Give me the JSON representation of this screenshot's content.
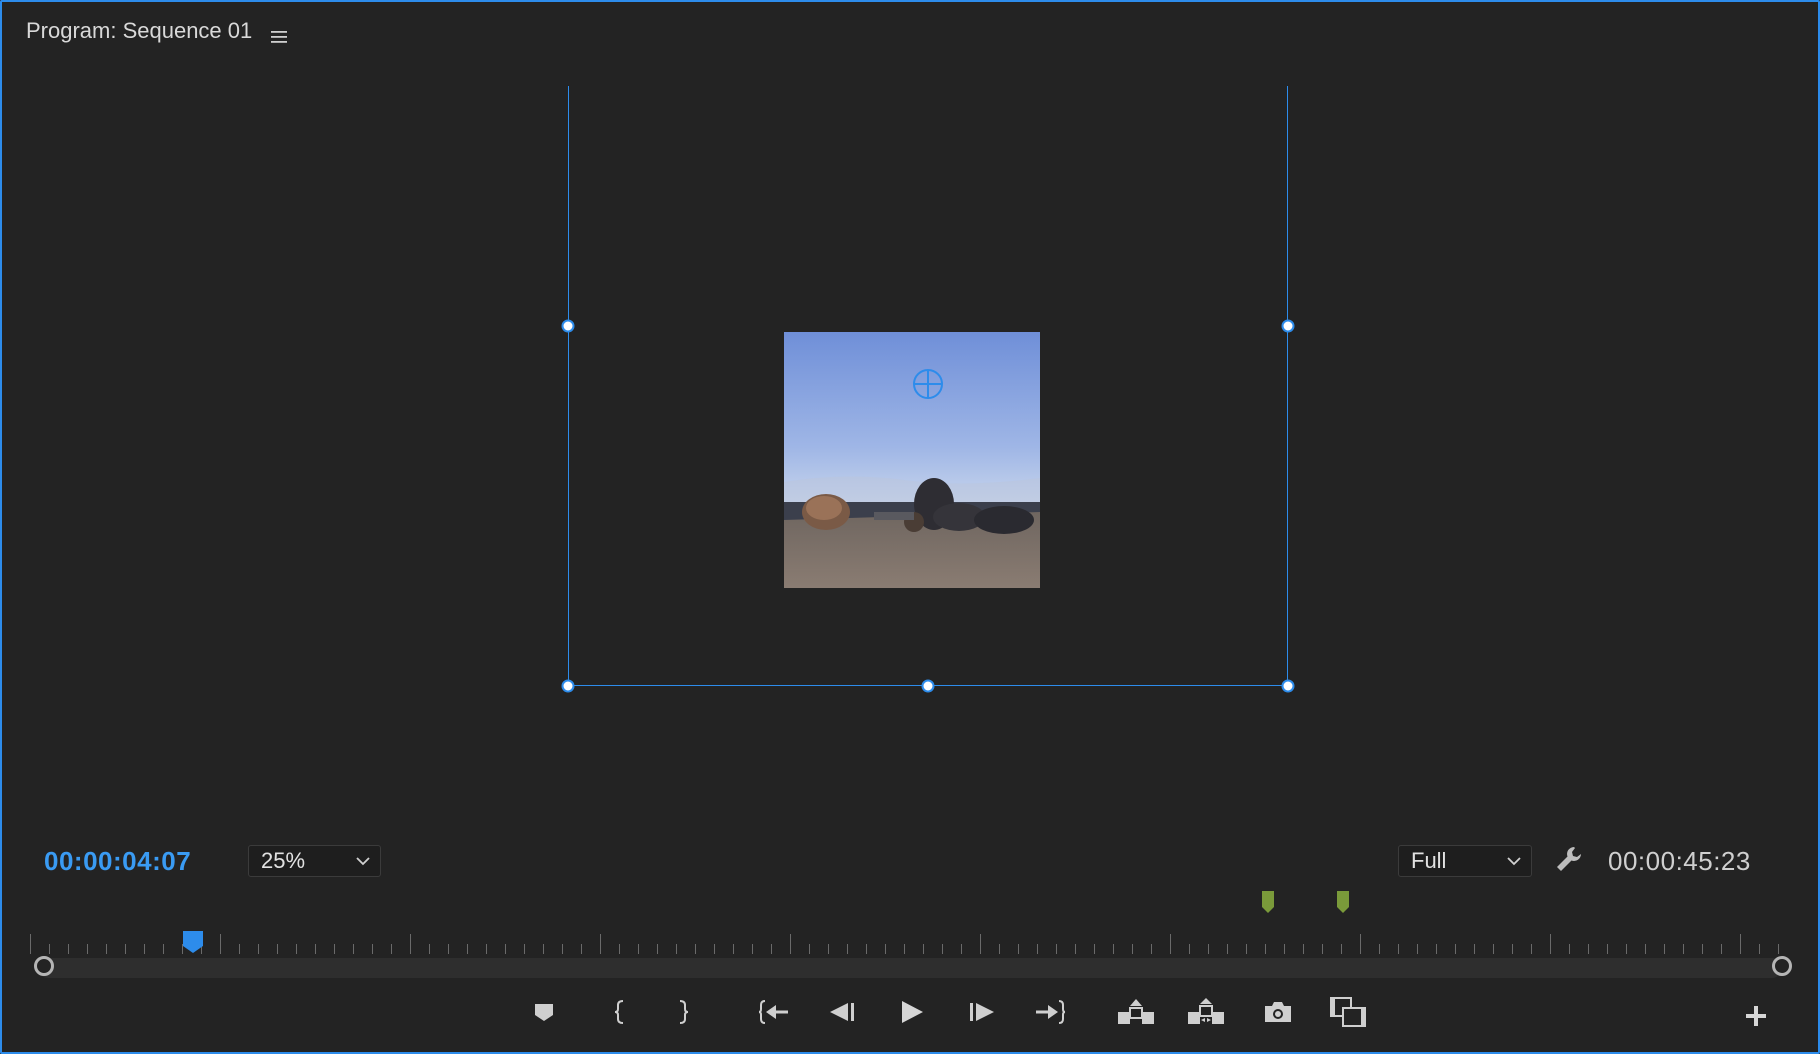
{
  "panel": {
    "title": "Program: Sequence 01",
    "menu_icon": "hamburger-menu-icon"
  },
  "viewer": {
    "frame_description": "sky-and-rocks-landscape"
  },
  "playback": {
    "current_timecode": "00:00:04:07",
    "duration_timecode": "00:00:45:23"
  },
  "zoom": {
    "value": "25%"
  },
  "resolution": {
    "value": "Full"
  },
  "colors": {
    "accent": "#2d8ceb",
    "timecode": "#3a9bf3",
    "marker": "#7a9a3a"
  },
  "controls": [
    {
      "name": "add-marker-button",
      "icon": "marker-icon"
    },
    {
      "name": "mark-in-button",
      "icon": "mark-in-icon"
    },
    {
      "name": "mark-out-button",
      "icon": "mark-out-icon"
    },
    {
      "name": "go-to-in-button",
      "icon": "go-to-in-icon"
    },
    {
      "name": "step-back-button",
      "icon": "step-back-icon"
    },
    {
      "name": "play-button",
      "icon": "play-icon"
    },
    {
      "name": "step-forward-button",
      "icon": "step-forward-icon"
    },
    {
      "name": "go-to-out-button",
      "icon": "go-to-out-icon"
    },
    {
      "name": "lift-button",
      "icon": "lift-icon"
    },
    {
      "name": "extract-button",
      "icon": "extract-icon"
    },
    {
      "name": "export-frame-button",
      "icon": "camera-icon"
    },
    {
      "name": "comparison-view-button",
      "icon": "comparison-view-icon"
    }
  ]
}
